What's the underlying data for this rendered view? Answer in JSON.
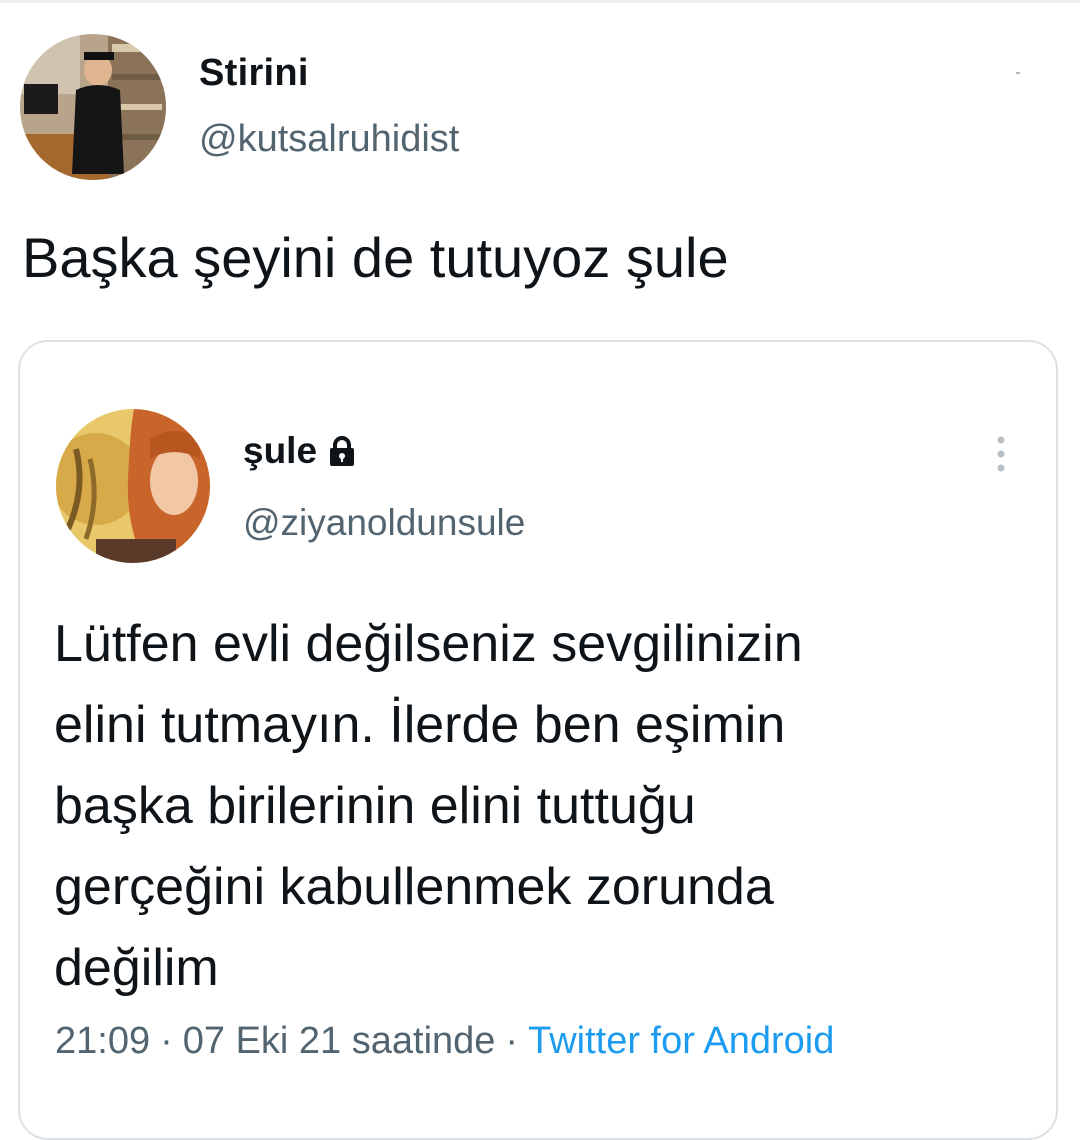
{
  "tweet": {
    "author": {
      "name": "Stirini",
      "handle": "@kutsalruhidist",
      "avatar_icon": "profile-photo"
    },
    "text": "Başka şeyini de tutuyoz şule"
  },
  "quoted_tweet": {
    "author": {
      "name": "şule",
      "handle": "@ziyanoldunsule",
      "protected_icon": "lock-icon",
      "avatar_icon": "profile-photo"
    },
    "text_lines": [
      "Lütfen evli değilseniz sevgilinizin",
      "elini tutmayın. İlerde ben eşimin",
      "başka birilerinin elini tuttuğu",
      "gerçeğini kabullenmek zorunda",
      "değilim"
    ],
    "time": "21:09",
    "date": "07 Eki 21 saatinde",
    "separator": "·",
    "source": "Twitter for Android",
    "menu_icon": "more-vertical-icon"
  },
  "colors": {
    "text_primary": "#0f1419",
    "text_secondary": "#536471",
    "link": "#1d9bf0",
    "card_border": "#dde2e6"
  }
}
